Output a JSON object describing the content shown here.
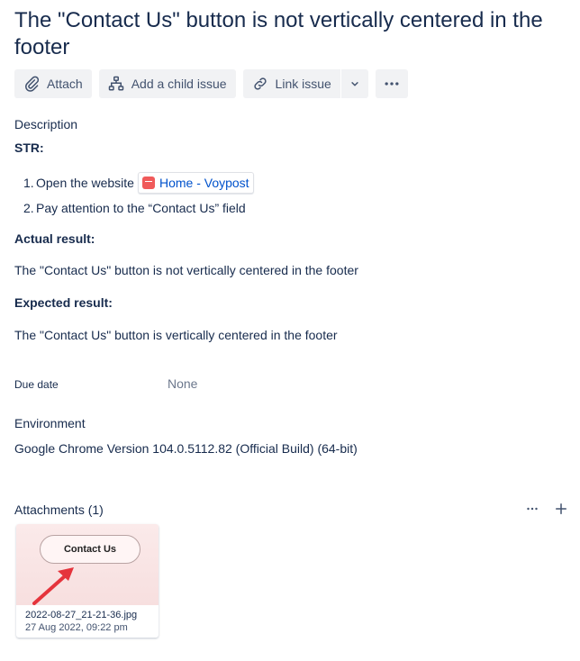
{
  "issue": {
    "title": "The \"Contact Us\" button is not vertically centered in the footer"
  },
  "toolbar": {
    "attach": "Attach",
    "add_child": "Add a child issue",
    "link_issue": "Link issue"
  },
  "description": {
    "heading": "Description",
    "str_label": "STR:",
    "steps": [
      {
        "num": "1.",
        "text": "Open the website",
        "link": "Home - Voypost"
      },
      {
        "num": "2.",
        "text": "Pay attention to the “Contact Us” field"
      }
    ],
    "actual_label": "Actual result:",
    "actual_text": "The \"Contact Us\" button is not vertically centered in the footer",
    "expected_label": "Expected result:",
    "expected_text": "The \"Contact Us\" button is vertically centered in the footer"
  },
  "due_date": {
    "label": "Due date",
    "value": "None"
  },
  "environment": {
    "heading": "Environment",
    "value": "Google Chrome Version 104.0.5112.82 (Official Build) (64-bit)"
  },
  "attachments": {
    "heading": "Attachments (1)",
    "items": [
      {
        "thumb_label": "Contact Us",
        "filename": "2022-08-27_21-21-36.jpg",
        "date": "27 Aug 2022, 09:22 pm"
      }
    ]
  },
  "icons": {
    "attach": "paperclip-icon",
    "child": "hierarchy-icon",
    "link": "link-icon",
    "chevron": "chevron-down-icon",
    "more": "more-icon",
    "plus": "plus-icon"
  },
  "colors": {
    "link": "#0052cc",
    "favicon": "#f05a5a",
    "arrow": "#e5343c"
  }
}
